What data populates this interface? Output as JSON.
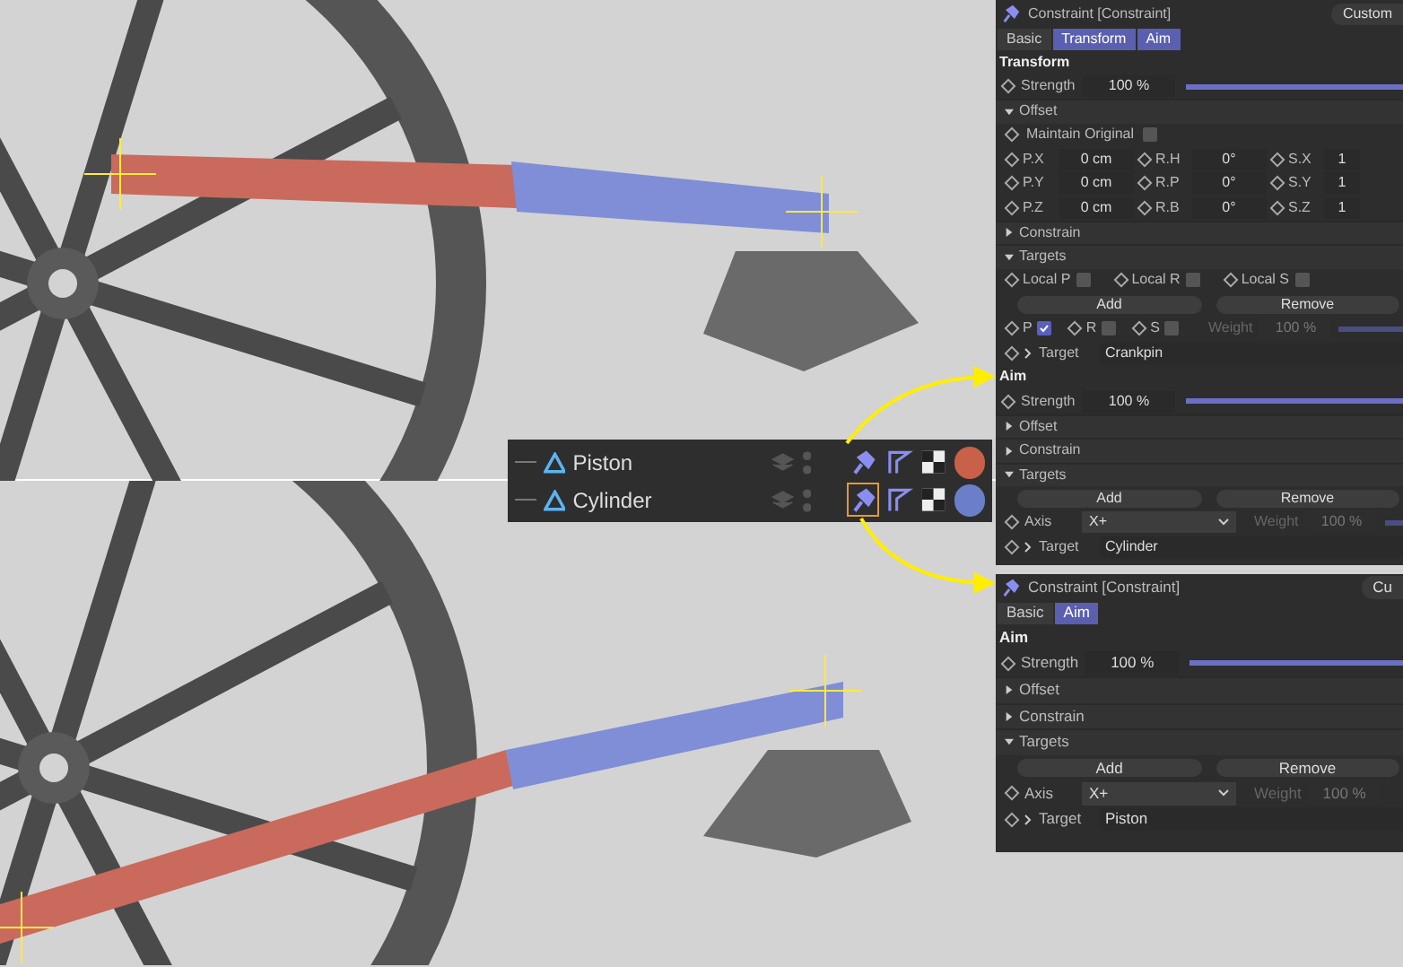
{
  "object_manager": {
    "rows": [
      {
        "name": "Piston",
        "color": "#c8604a",
        "tag_selected": false
      },
      {
        "name": "Cylinder",
        "color": "#6a7fc8",
        "tag_selected": true
      }
    ]
  },
  "panels": [
    {
      "title": "Constraint [Constraint]",
      "menu_button": "Custom",
      "tabs": [
        {
          "label": "Basic",
          "selected": false
        },
        {
          "label": "Transform",
          "selected": true
        },
        {
          "label": "Aim",
          "selected": true
        }
      ],
      "rows": [
        {
          "kind": "heading",
          "label": "Transform"
        },
        {
          "kind": "slider",
          "label": "Strength",
          "value": "100 %",
          "level": 1
        },
        {
          "kind": "group",
          "label": "Offset",
          "expanded": true
        },
        {
          "kind": "checkbox",
          "label": "Maintain Original",
          "checked": false
        },
        {
          "kind": "fields",
          "items": [
            {
              "label": "P.X",
              "value": "0 cm"
            },
            {
              "label": "R.H",
              "value": "0°"
            },
            {
              "label": "S.X",
              "value": "1"
            }
          ]
        },
        {
          "kind": "fields",
          "items": [
            {
              "label": "P.Y",
              "value": "0 cm"
            },
            {
              "label": "R.P",
              "value": "0°"
            },
            {
              "label": "S.Y",
              "value": "1"
            }
          ]
        },
        {
          "kind": "fields",
          "items": [
            {
              "label": "P.Z",
              "value": "0 cm"
            },
            {
              "label": "R.B",
              "value": "0°"
            },
            {
              "label": "S.Z",
              "value": "1"
            }
          ]
        },
        {
          "kind": "group",
          "label": "Constrain",
          "expanded": false
        },
        {
          "kind": "group",
          "label": "Targets",
          "expanded": true
        },
        {
          "kind": "checks",
          "items": [
            {
              "label": "Local P",
              "checked": false
            },
            {
              "label": "Local R",
              "checked": false
            },
            {
              "label": "Local S",
              "checked": false
            }
          ]
        },
        {
          "kind": "buttons",
          "items": [
            "Add",
            "Remove"
          ]
        },
        {
          "kind": "prs",
          "items": [
            {
              "label": "P",
              "checked": true
            },
            {
              "label": "R",
              "checked": false
            },
            {
              "label": "S",
              "checked": false
            }
          ],
          "weight_label": "Weight",
          "weight_value": "100 %",
          "level": 1
        },
        {
          "kind": "target",
          "label": "Target",
          "value": "Crankpin"
        },
        {
          "kind": "heading",
          "label": "Aim"
        },
        {
          "kind": "slider",
          "label": "Strength",
          "value": "100 %",
          "level": 1
        },
        {
          "kind": "group",
          "label": "Offset",
          "expanded": false
        },
        {
          "kind": "group",
          "label": "Constrain",
          "expanded": false
        },
        {
          "kind": "group",
          "label": "Targets",
          "expanded": true
        },
        {
          "kind": "buttons",
          "items": [
            "Add",
            "Remove"
          ]
        },
        {
          "kind": "axis",
          "label": "Axis",
          "value": "X+",
          "weight_label": "Weight",
          "weight_value": "100 %",
          "level": 1
        },
        {
          "kind": "target",
          "label": "Target",
          "value": "Cylinder"
        }
      ]
    },
    {
      "title": "Constraint [Constraint]",
      "menu_button": "Cu",
      "tabs": [
        {
          "label": "Basic",
          "selected": false
        },
        {
          "label": "Aim",
          "selected": true
        }
      ],
      "rows": [
        {
          "kind": "heading",
          "label": "Aim"
        },
        {
          "kind": "slider",
          "label": "Strength",
          "value": "100 %",
          "level": 1
        },
        {
          "kind": "group",
          "label": "Offset",
          "expanded": false
        },
        {
          "kind": "group",
          "label": "Constrain",
          "expanded": false
        },
        {
          "kind": "group",
          "label": "Targets",
          "expanded": true
        },
        {
          "kind": "buttons",
          "items": [
            "Add",
            "Remove"
          ]
        },
        {
          "kind": "axis",
          "label": "Axis",
          "value": "X+",
          "weight_label": "Weight",
          "weight_value": "100 %"
        },
        {
          "kind": "target",
          "label": "Target",
          "value": "Piston"
        }
      ]
    }
  ]
}
